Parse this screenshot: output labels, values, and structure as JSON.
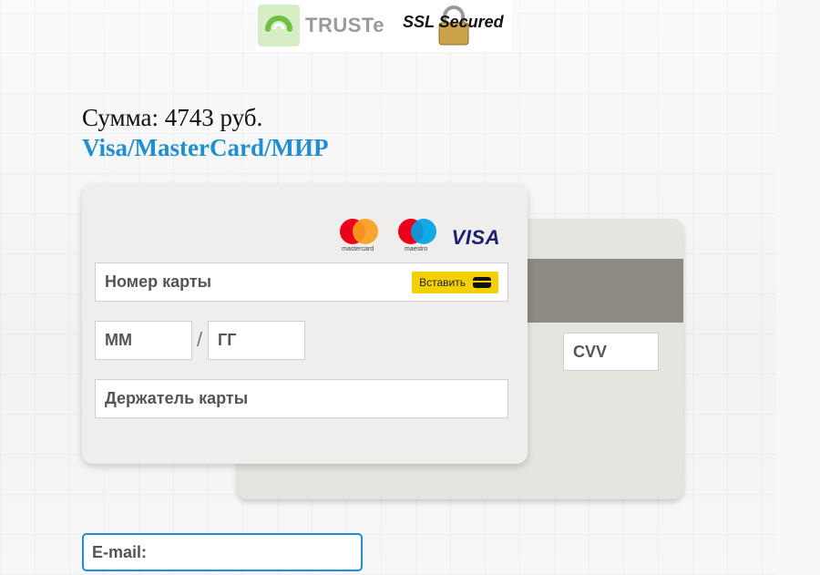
{
  "badges": {
    "truste_label": "TRUSTe",
    "ssl_label": "SSL Secured"
  },
  "payment": {
    "amount_label": "Сумма: 4743 руб.",
    "card_types_label": "Visa/MasterCard/МИР"
  },
  "card_logos": {
    "mastercard_caption": "mastercard",
    "maestro_caption": "maestro",
    "visa_label": "VISA"
  },
  "form": {
    "card_number_placeholder": "Номер карты",
    "paste_button_label": "Вставить",
    "month_placeholder": "ММ",
    "date_separator": "/",
    "year_placeholder": "ГГ",
    "holder_placeholder": "Держатель карты",
    "cvv_placeholder": "CVV",
    "email_placeholder": "E-mail:"
  },
  "colors": {
    "accent": "#1e8fd0",
    "paste_button": "#f5d000",
    "mastercard_red": "#eb001b",
    "mastercard_orange": "#f79e1b",
    "maestro_blue": "#00a2e5",
    "visa_navy": "#1a1f71"
  }
}
